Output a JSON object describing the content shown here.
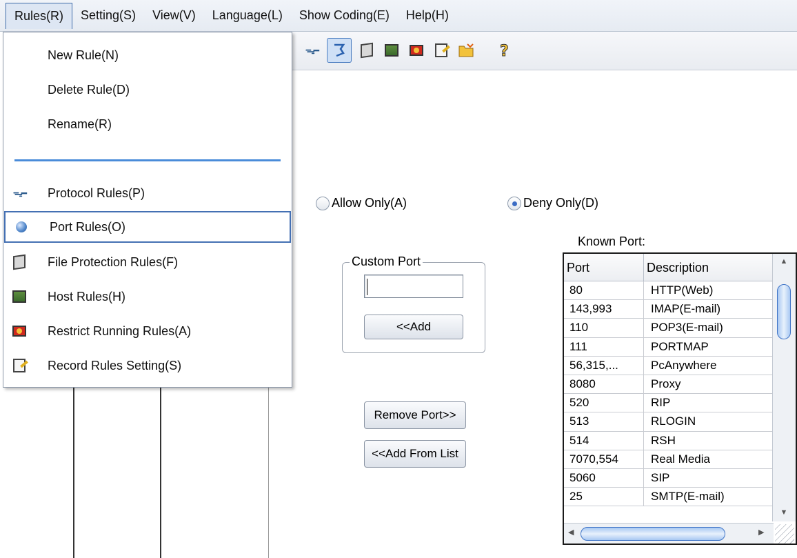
{
  "menubar": {
    "items": [
      {
        "label": "Rules(R)"
      },
      {
        "label": "Setting(S)"
      },
      {
        "label": "View(V)"
      },
      {
        "label": "Language(L)"
      },
      {
        "label": "Show Coding(E)"
      },
      {
        "label": "Help(H)"
      }
    ]
  },
  "dropdown": {
    "items": [
      {
        "label": "New Rule(N)"
      },
      {
        "label": "Delete Rule(D)"
      },
      {
        "label": "Rename(R)"
      },
      {
        "label": "Protocol Rules(P)",
        "icon": "protocol-icon"
      },
      {
        "label": "Port Rules(O)",
        "icon": "port-icon"
      },
      {
        "label": "File Protection Rules(F)",
        "icon": "file-protection-icon"
      },
      {
        "label": "Host Rules(H)",
        "icon": "host-icon"
      },
      {
        "label": "Restrict Running Rules(A)",
        "icon": "restrict-running-icon"
      },
      {
        "label": "Record Rules Setting(S)",
        "icon": "record-rules-icon"
      }
    ]
  },
  "toolbar": {
    "icons": [
      "protocol-icon",
      "port-icon",
      "file-protection-icon",
      "host-icon",
      "restrict-running-icon",
      "record-rules-icon",
      "folder-icon",
      "help-icon"
    ]
  },
  "mode": {
    "allow_label": "Allow Only(A)",
    "deny_label": "Deny Only(D)",
    "selected": "deny"
  },
  "custom_port": {
    "title": "Custom Port",
    "value": "",
    "add_label": "<<Add"
  },
  "buttons": {
    "remove_port": "Remove Port>>",
    "add_from_list": "<<Add From List"
  },
  "known_ports": {
    "label": "Known Port:",
    "columns": [
      "Port",
      "Description"
    ],
    "rows": [
      {
        "port": "80",
        "desc": "HTTP(Web)"
      },
      {
        "port": "143,993",
        "desc": "IMAP(E-mail)"
      },
      {
        "port": "110",
        "desc": "POP3(E-mail)"
      },
      {
        "port": "111",
        "desc": "PORTMAP"
      },
      {
        "port": "56,315,...",
        "desc": "PcAnywhere"
      },
      {
        "port": "8080",
        "desc": "Proxy"
      },
      {
        "port": "520",
        "desc": "RIP"
      },
      {
        "port": "513",
        "desc": "RLOGIN"
      },
      {
        "port": "514",
        "desc": "RSH"
      },
      {
        "port": "7070,554",
        "desc": "Real Media"
      },
      {
        "port": "5060",
        "desc": "SIP"
      },
      {
        "port": "25",
        "desc": "SMTP(E-mail)"
      }
    ]
  },
  "colors": {
    "accent": "#4470b3",
    "separator": "#4a8cd9"
  }
}
